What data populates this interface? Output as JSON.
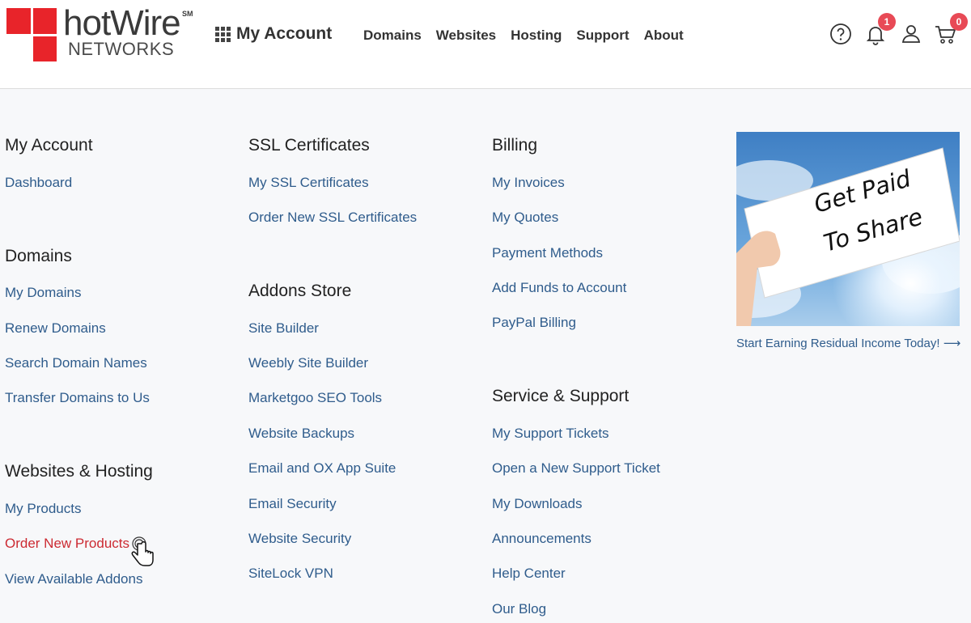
{
  "logo": {
    "word": "hotWire",
    "sm": "SM",
    "sub": "NETWORKS"
  },
  "header": {
    "menu_title": "My Account",
    "nav": [
      "Domains",
      "Websites",
      "Hosting",
      "Support",
      "About"
    ],
    "notifications_count": "1",
    "cart_count": "0"
  },
  "colors": {
    "brand_red": "#e8242a",
    "link_blue": "#2f5c8c",
    "active_red": "#cc2a32",
    "badge": "#e84a56"
  },
  "icons": [
    "help-icon",
    "bell-icon",
    "user-icon",
    "cart-icon",
    "grid-icon"
  ],
  "columns": {
    "c1": {
      "my_account": {
        "title": "My Account",
        "links": [
          "Dashboard"
        ]
      },
      "domains": {
        "title": "Domains",
        "links": [
          "My Domains",
          "Renew Domains",
          "Search Domain Names",
          "Transfer Domains to Us"
        ]
      },
      "websites_hosting": {
        "title": "Websites & Hosting",
        "links": [
          "My Products",
          "Order New Products",
          "View Available Addons"
        ]
      }
    },
    "c2": {
      "ssl": {
        "title": "SSL Certificates",
        "links": [
          "My SSL Certificates",
          "Order New SSL Certificates"
        ]
      },
      "addons": {
        "title": "Addons Store",
        "links": [
          "Site Builder",
          "Weebly Site Builder",
          "Marketgoo SEO Tools",
          "Website Backups",
          "Email and OX App Suite",
          "Email Security",
          "Website Security",
          "SiteLock VPN"
        ]
      }
    },
    "c3": {
      "billing": {
        "title": "Billing",
        "links": [
          "My Invoices",
          "My Quotes",
          "Payment Methods",
          "Add Funds to Account",
          "PayPal Billing"
        ]
      },
      "support": {
        "title": "Service & Support",
        "links": [
          "My Support Tickets",
          "Open a New Support Ticket",
          "My Downloads",
          "Announcements",
          "Help Center",
          "Our Blog"
        ]
      }
    }
  },
  "promo": {
    "sign_line1": "Get Paid",
    "sign_line2": "To Share",
    "link": "Start Earning Residual Income Today! ⟶"
  }
}
